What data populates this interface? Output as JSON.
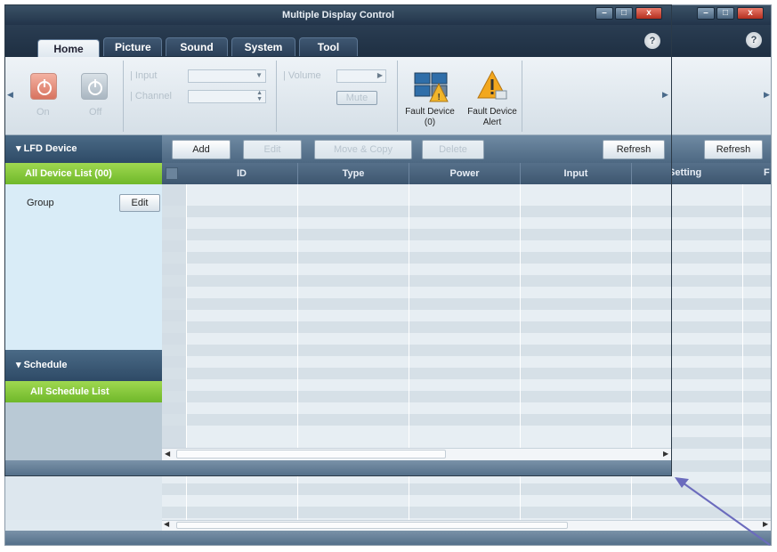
{
  "window": {
    "title": "Multiple Display Control",
    "min_label": "–",
    "max_label": "□",
    "close_label": "x",
    "help_label": "?"
  },
  "tabs": [
    "Home",
    "Picture",
    "Sound",
    "System",
    "Tool"
  ],
  "ribbon": {
    "power_on": "On",
    "power_off": "Off",
    "input_label": "Input",
    "channel_label": "Channel",
    "volume_label": "Volume",
    "mute_label": "Mute",
    "fault_device": "Fault Device (0)",
    "fault_alert": "Fault Device Alert"
  },
  "sidebar": {
    "device_header": "LFD Device",
    "all_devices": "All Device List (00)",
    "group_label": "Group",
    "group_edit": "Edit",
    "schedule_header": "Schedule",
    "all_schedule": "All Schedule List"
  },
  "toolbar": {
    "add": "Add",
    "edit": "Edit",
    "move_copy": "Move & Copy",
    "delete": "Delete",
    "refresh": "Refresh"
  },
  "grid": {
    "columns": [
      "ID",
      "Type",
      "Power",
      "Input",
      "Setting",
      "F"
    ]
  },
  "colors": {
    "title_bar": "#2d4259",
    "green_selection": "#86c83c",
    "arrow": "#6b6bbd"
  }
}
